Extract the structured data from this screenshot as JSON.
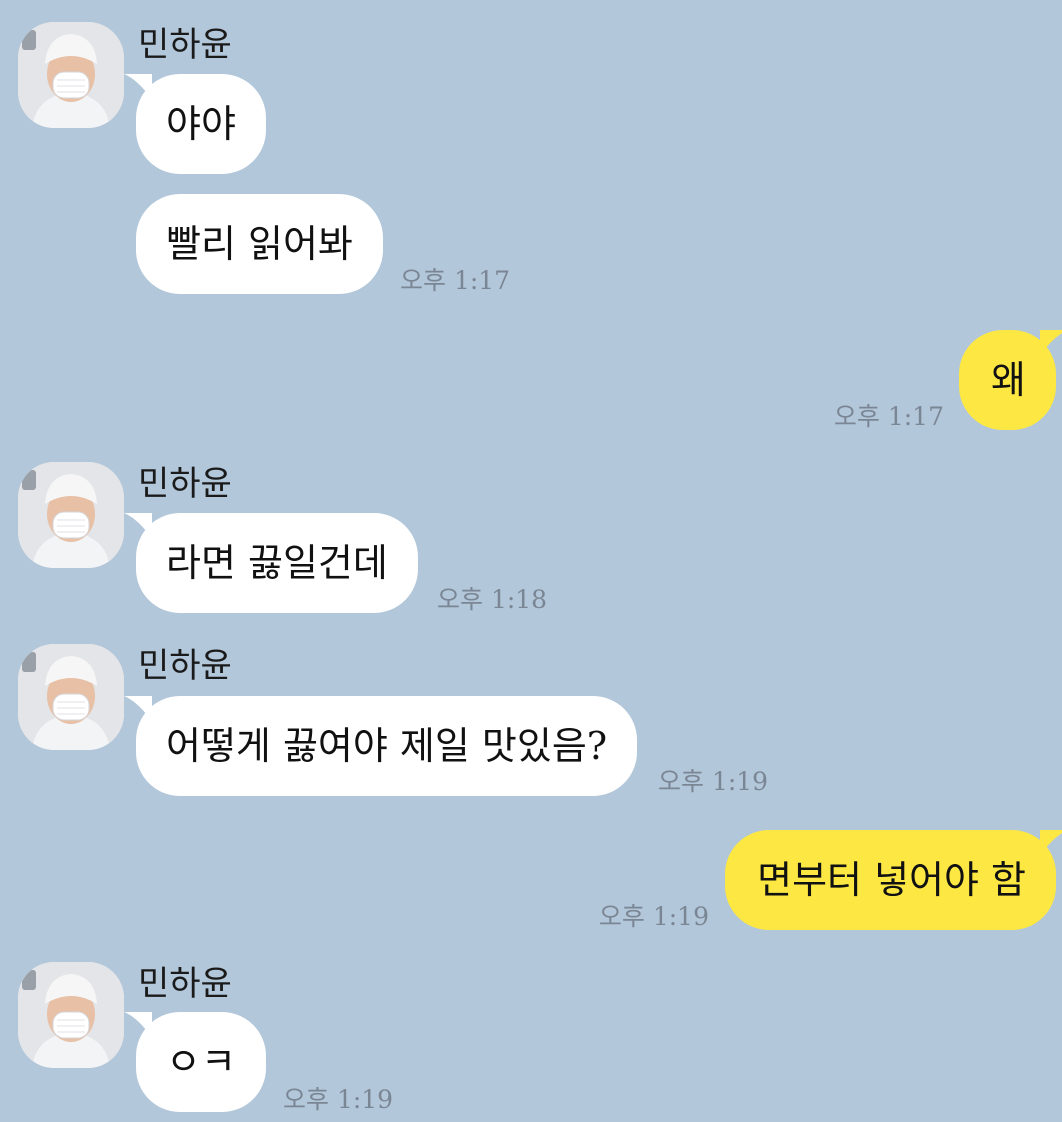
{
  "colors": {
    "background": "#b2c7da",
    "incoming_bubble": "#ffffff",
    "outgoing_bubble": "#fde843",
    "timestamp": "#7b8694"
  },
  "groups": [
    {
      "sender": "민하윤",
      "avatar_icon": "profile-avatar-icon",
      "messages": [
        {
          "text": "야야"
        },
        {
          "text": "빨리 읽어봐",
          "time": "오후 1:17"
        }
      ]
    },
    {
      "outgoing": true,
      "messages": [
        {
          "text": "왜",
          "time": "오후 1:17"
        }
      ]
    },
    {
      "sender": "민하윤",
      "avatar_icon": "profile-avatar-icon",
      "messages": [
        {
          "text": "라면 끓일건데",
          "time": "오후 1:18"
        }
      ]
    },
    {
      "sender": "민하윤",
      "avatar_icon": "profile-avatar-icon",
      "messages": [
        {
          "text": "어떻게 끓여야 제일 맛있음?",
          "time": "오후 1:19"
        }
      ]
    },
    {
      "outgoing": true,
      "messages": [
        {
          "text": "면부터 넣어야 함",
          "time": "오후 1:19"
        }
      ]
    },
    {
      "sender": "민하윤",
      "avatar_icon": "profile-avatar-icon",
      "messages": [
        {
          "text": "ㅇㅋ",
          "time": "오후 1:19"
        }
      ]
    }
  ]
}
